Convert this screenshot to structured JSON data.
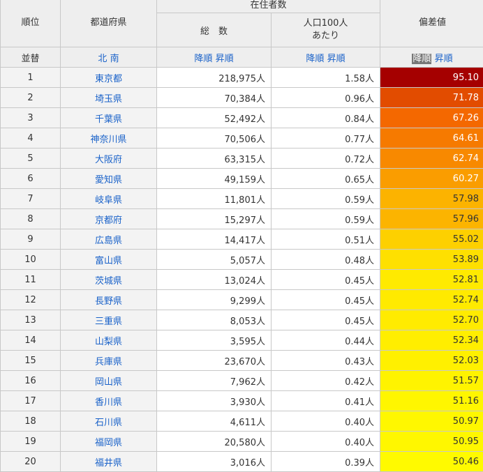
{
  "header": {
    "rank": "順位",
    "pref": "都道府県",
    "group": "在住者数",
    "total": "総　数",
    "per100_line1": "人口100人",
    "per100_line2": "あたり",
    "deviation": "偏差値"
  },
  "sort": {
    "col1": "並替",
    "north": "北",
    "south": "南",
    "desc": "降順",
    "asc": "昇順"
  },
  "rows": [
    {
      "rank": "1",
      "pref": "東京都",
      "total": "218,975人",
      "per100": "1.58人",
      "dev": "95.10",
      "color": "#a50000",
      "textColor": "#ffffff"
    },
    {
      "rank": "2",
      "pref": "埼玉県",
      "total": "70,384人",
      "per100": "0.96人",
      "dev": "71.78",
      "color": "#e24c00",
      "textColor": "#ffffff"
    },
    {
      "rank": "3",
      "pref": "千葉県",
      "total": "52,492人",
      "per100": "0.84人",
      "dev": "67.26",
      "color": "#f46800",
      "textColor": "#ffffff"
    },
    {
      "rank": "4",
      "pref": "神奈川県",
      "total": "70,506人",
      "per100": "0.77人",
      "dev": "64.61",
      "color": "#f67a00",
      "textColor": "#ffffff"
    },
    {
      "rank": "5",
      "pref": "大阪府",
      "total": "63,315人",
      "per100": "0.72人",
      "dev": "62.74",
      "color": "#f88900",
      "textColor": "#ffffff"
    },
    {
      "rank": "6",
      "pref": "愛知県",
      "total": "49,159人",
      "per100": "0.65人",
      "dev": "60.27",
      "color": "#fa9d00",
      "textColor": "#ffffff"
    },
    {
      "rank": "7",
      "pref": "岐阜県",
      "total": "11,801人",
      "per100": "0.59人",
      "dev": "57.98",
      "color": "#fcb300",
      "textColor": "#333333"
    },
    {
      "rank": "8",
      "pref": "京都府",
      "total": "15,297人",
      "per100": "0.59人",
      "dev": "57.96",
      "color": "#fcb400",
      "textColor": "#333333"
    },
    {
      "rank": "9",
      "pref": "広島県",
      "total": "14,417人",
      "per100": "0.51人",
      "dev": "55.02",
      "color": "#fdd000",
      "textColor": "#333333"
    },
    {
      "rank": "10",
      "pref": "富山県",
      "total": "5,057人",
      "per100": "0.48人",
      "dev": "53.89",
      "color": "#fee000",
      "textColor": "#333333"
    },
    {
      "rank": "11",
      "pref": "茨城県",
      "total": "13,024人",
      "per100": "0.45人",
      "dev": "52.81",
      "color": "#ffea00",
      "textColor": "#333333"
    },
    {
      "rank": "12",
      "pref": "長野県",
      "total": "9,299人",
      "per100": "0.45人",
      "dev": "52.74",
      "color": "#ffea00",
      "textColor": "#333333"
    },
    {
      "rank": "13",
      "pref": "三重県",
      "total": "8,053人",
      "per100": "0.45人",
      "dev": "52.70",
      "color": "#ffeb00",
      "textColor": "#333333"
    },
    {
      "rank": "14",
      "pref": "山梨県",
      "total": "3,595人",
      "per100": "0.44人",
      "dev": "52.34",
      "color": "#ffee00",
      "textColor": "#333333"
    },
    {
      "rank": "15",
      "pref": "兵庫県",
      "total": "23,670人",
      "per100": "0.43人",
      "dev": "52.03",
      "color": "#fff000",
      "textColor": "#333333"
    },
    {
      "rank": "16",
      "pref": "岡山県",
      "total": "7,962人",
      "per100": "0.42人",
      "dev": "51.57",
      "color": "#fff300",
      "textColor": "#333333"
    },
    {
      "rank": "17",
      "pref": "香川県",
      "total": "3,930人",
      "per100": "0.41人",
      "dev": "51.16",
      "color": "#fff600",
      "textColor": "#333333"
    },
    {
      "rank": "18",
      "pref": "石川県",
      "total": "4,611人",
      "per100": "0.40人",
      "dev": "50.97",
      "color": "#fff700",
      "textColor": "#333333"
    },
    {
      "rank": "19",
      "pref": "福岡県",
      "total": "20,580人",
      "per100": "0.40人",
      "dev": "50.95",
      "color": "#fff700",
      "textColor": "#333333"
    },
    {
      "rank": "20",
      "pref": "福井県",
      "total": "3,016人",
      "per100": "0.39人",
      "dev": "50.46",
      "color": "#fffa00",
      "textColor": "#333333"
    }
  ]
}
